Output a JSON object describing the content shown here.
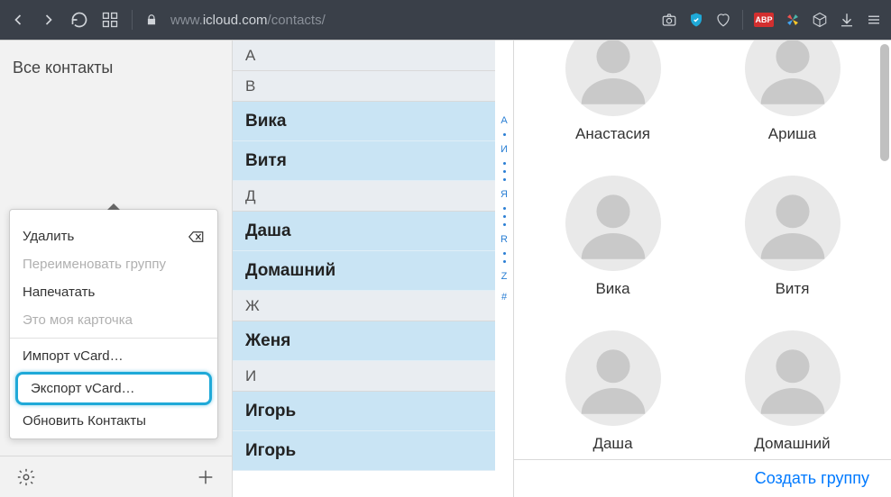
{
  "browser": {
    "url_prefix": "www.",
    "url_domain": "icloud.com",
    "url_path": "/contacts/",
    "abp_label": "ABP"
  },
  "sidebar": {
    "title": "Все контакты"
  },
  "popup": {
    "items": [
      {
        "label": "Удалить",
        "disabled": false,
        "has_backspace_icon": true
      },
      {
        "label": "Переименовать группу",
        "disabled": true
      },
      {
        "label": "Напечатать",
        "disabled": false
      },
      {
        "label": "Это моя карточка",
        "disabled": true
      },
      {
        "label": "Импорт vCard…",
        "disabled": false
      },
      {
        "label": "Экспорт vCard…",
        "disabled": false,
        "highlight": true
      },
      {
        "label": "Обновить Контакты",
        "disabled": false
      }
    ]
  },
  "list": {
    "rows": [
      {
        "type": "header",
        "label": "А"
      },
      {
        "type": "header",
        "label": "В"
      },
      {
        "type": "item",
        "label": "Вика"
      },
      {
        "type": "item",
        "label": "Витя"
      },
      {
        "type": "header",
        "label": "Д"
      },
      {
        "type": "item",
        "label": "Даша"
      },
      {
        "type": "item",
        "label": "Домашний"
      },
      {
        "type": "header",
        "label": "Ж"
      },
      {
        "type": "item",
        "label": "Женя"
      },
      {
        "type": "header",
        "label": "И"
      },
      {
        "type": "item",
        "label": "Игорь"
      },
      {
        "type": "item",
        "label": "Игорь"
      }
    ],
    "index": [
      "А",
      "И",
      "Я",
      "R",
      "Z",
      "#"
    ]
  },
  "cards": {
    "names": [
      "Анастасия",
      "Ариша",
      "Вика",
      "Витя",
      "Даша",
      "Домашний"
    ],
    "footer_link": "Создать группу"
  }
}
